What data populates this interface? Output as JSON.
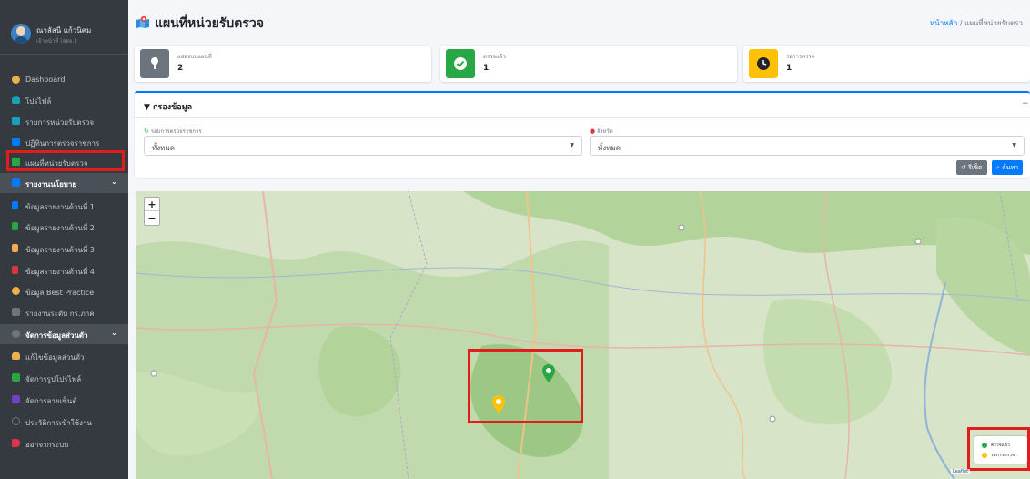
{
  "user": {
    "name": "ณาลัสนี แก้วนิคม",
    "role": "เจ้าหน้าที่ (สสจ.)"
  },
  "sidebar": {
    "items": [
      {
        "label": "Dashboard",
        "icon": "dashboard-icon",
        "color": "#f0ad4e"
      },
      {
        "label": "โปรไฟล์",
        "icon": "user-icon",
        "color": "#17a2b8"
      },
      {
        "label": "รายการหน่วยรับตรวจ",
        "icon": "list-icon",
        "color": "#17a2b8"
      },
      {
        "label": "ปฏิทินการตรวจราชการ",
        "icon": "calendar-icon",
        "color": "#007bff"
      },
      {
        "label": "แผนที่หน่วยรับตรวจ",
        "icon": "map-icon",
        "color": "#28a745"
      },
      {
        "label": "รายงานนโยบาย",
        "icon": "report-icon",
        "color": "#007bff"
      },
      {
        "label": "ข้อมูลรายงานด้านที่ 1",
        "icon": "file-icon",
        "color": "#007bff"
      },
      {
        "label": "ข้อมูลรายงานด้านที่ 2",
        "icon": "file-icon",
        "color": "#28a745"
      },
      {
        "label": "ข้อมูลรายงานด้านที่ 3",
        "icon": "file-icon",
        "color": "#f0ad4e"
      },
      {
        "label": "ข้อมูลรายงานด้านที่ 4",
        "icon": "file-icon",
        "color": "#dc3545"
      },
      {
        "label": "ข้อมูล Best Practice",
        "icon": "award-icon",
        "color": "#f0ad4e"
      },
      {
        "label": "รายงานระดับ กร.ภาค",
        "icon": "chart-icon",
        "color": "#6c757d"
      },
      {
        "label": "จัดการข้อมูลส่วนตัว",
        "icon": "settings-icon",
        "color": "#6c757d"
      },
      {
        "label": "แก้ไขข้อมูลส่วนตัว",
        "icon": "user-edit-icon",
        "color": "#f0ad4e"
      },
      {
        "label": "จัดการรูปโปรไฟล์",
        "icon": "image-icon",
        "color": "#28a745"
      },
      {
        "label": "จัดการลายเซ็นต์",
        "icon": "signature-icon",
        "color": "#6f42c1"
      },
      {
        "label": "ประวัติการเข้าใช้งาน",
        "icon": "history-icon",
        "color": "#6c757d"
      },
      {
        "label": "ออกจากระบบ",
        "icon": "logout-icon",
        "color": "#dc3545"
      }
    ]
  },
  "header": {
    "title": "แผนที่หน่วยรับตรวจ",
    "breadcrumb_home": "หน้าหลัก",
    "breadcrumb_sep": "/",
    "breadcrumb_current": "แผนที่หน่วยรับตรว"
  },
  "stats": [
    {
      "label": "แสดงบนแผนที่",
      "value": "2",
      "color": "#6c757d"
    },
    {
      "label": "ตรวจแล้ว",
      "value": "1",
      "color": "#28a745"
    },
    {
      "label": "รอการตรวจ",
      "value": "1",
      "color": "#ffc107"
    }
  ],
  "filter": {
    "title": "กรองข้อมูล",
    "round_label": "รอบการตรวจราชการ",
    "round_value": "ทั้งหมด",
    "province_label": "จังหวัด",
    "province_value": "ทั้งหมด",
    "reset_label": "รีเซ็ต",
    "search_label": "ค้นหา"
  },
  "map": {
    "zoom_in": "+",
    "zoom_out": "−",
    "legend_done": "ตรวจแล้ว",
    "legend_pending": "รอการตรวจ",
    "attribution": "Leaflet"
  },
  "colors": {
    "accent": "#007bff",
    "done": "#28a745",
    "pending": "#ffc107",
    "highlight": "#e01c1c"
  }
}
